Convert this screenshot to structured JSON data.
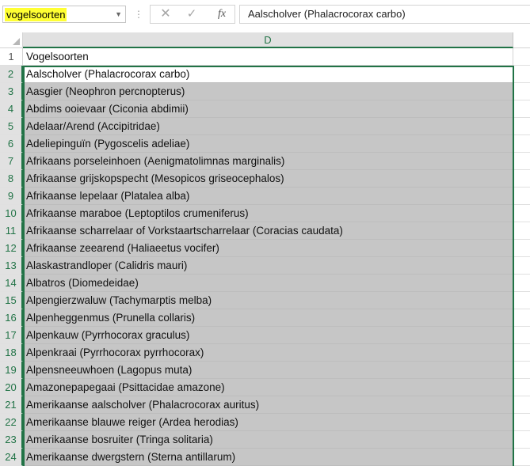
{
  "formula_bar": {
    "name_box": "vogelsoorten",
    "dots": "⋮",
    "cancel_icon": "✕",
    "enter_icon": "✓",
    "fx_label": "fx",
    "value": "Aalscholver (Phalacrocorax carbo)"
  },
  "grid": {
    "column_header": "D",
    "rows": [
      {
        "num": "1",
        "text": "Vogelsoorten"
      },
      {
        "num": "2",
        "text": "Aalscholver (Phalacrocorax carbo)"
      },
      {
        "num": "3",
        "text": "Aasgier (Neophron percnopterus)"
      },
      {
        "num": "4",
        "text": "Abdims ooievaar (Ciconia abdimii)"
      },
      {
        "num": "5",
        "text": "Adelaar/Arend (Accipitridae)"
      },
      {
        "num": "6",
        "text": "Adeliepinguïn (Pygoscelis adeliae)"
      },
      {
        "num": "7",
        "text": "Afrikaans porseleinhoen (Aenigmatolimnas marginalis)"
      },
      {
        "num": "8",
        "text": "Afrikaanse grijskopspecht (Mesopicos griseocephalos)"
      },
      {
        "num": "9",
        "text": "Afrikaanse lepelaar (Platalea alba)"
      },
      {
        "num": "10",
        "text": "Afrikaanse maraboe (Leptoptilos crumeniferus)"
      },
      {
        "num": "11",
        "text": "Afrikaanse scharrelaar of Vorkstaartscharrelaar (Coracias caudata)"
      },
      {
        "num": "12",
        "text": "Afrikaanse zeearend (Haliaeetus vocifer)"
      },
      {
        "num": "13",
        "text": "Alaskastrandloper (Calidris mauri)"
      },
      {
        "num": "14",
        "text": "Albatros (Diomedeidae)"
      },
      {
        "num": "15",
        "text": "Alpengierzwaluw (Tachymarptis melba)"
      },
      {
        "num": "16",
        "text": "Alpenheggenmus (Prunella collaris)"
      },
      {
        "num": "17",
        "text": "Alpenkauw (Pyrrhocorax graculus)"
      },
      {
        "num": "18",
        "text": "Alpenkraai (Pyrrhocorax pyrrhocorax)"
      },
      {
        "num": "19",
        "text": "Alpensneeuwhoen (Lagopus muta)"
      },
      {
        "num": "20",
        "text": "Amazonepapegaai (Psittacidae amazone)"
      },
      {
        "num": "21",
        "text": "Amerikaanse aalscholver (Phalacrocorax auritus)"
      },
      {
        "num": "22",
        "text": "Amerikaanse blauwe reiger (Ardea herodias)"
      },
      {
        "num": "23",
        "text": "Amerikaanse bosruiter (Tringa solitaria)"
      },
      {
        "num": "24",
        "text": "Amerikaanse dwergstern (Sterna antillarum)"
      }
    ]
  },
  "colors": {
    "accent": "#217346",
    "name_box_highlight": "#ffff33",
    "selection_fill": "#c6c6c6"
  }
}
